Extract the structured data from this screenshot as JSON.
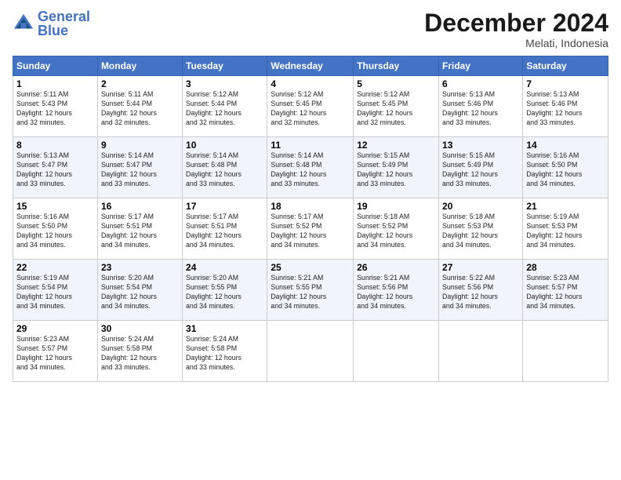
{
  "logo": {
    "line1": "General",
    "line2": "Blue"
  },
  "title": "December 2024",
  "location": "Melati, Indonesia",
  "days_header": [
    "Sunday",
    "Monday",
    "Tuesday",
    "Wednesday",
    "Thursday",
    "Friday",
    "Saturday"
  ],
  "weeks": [
    [
      {
        "day": "1",
        "sunrise": "5:11 AM",
        "sunset": "5:43 PM",
        "daylight": "12 hours and 32 minutes."
      },
      {
        "day": "2",
        "sunrise": "5:11 AM",
        "sunset": "5:44 PM",
        "daylight": "12 hours and 32 minutes."
      },
      {
        "day": "3",
        "sunrise": "5:12 AM",
        "sunset": "5:44 PM",
        "daylight": "12 hours and 32 minutes."
      },
      {
        "day": "4",
        "sunrise": "5:12 AM",
        "sunset": "5:45 PM",
        "daylight": "12 hours and 32 minutes."
      },
      {
        "day": "5",
        "sunrise": "5:12 AM",
        "sunset": "5:45 PM",
        "daylight": "12 hours and 32 minutes."
      },
      {
        "day": "6",
        "sunrise": "5:13 AM",
        "sunset": "5:46 PM",
        "daylight": "12 hours and 33 minutes."
      },
      {
        "day": "7",
        "sunrise": "5:13 AM",
        "sunset": "5:46 PM",
        "daylight": "12 hours and 33 minutes."
      }
    ],
    [
      {
        "day": "8",
        "sunrise": "5:13 AM",
        "sunset": "5:47 PM",
        "daylight": "12 hours and 33 minutes."
      },
      {
        "day": "9",
        "sunrise": "5:14 AM",
        "sunset": "5:47 PM",
        "daylight": "12 hours and 33 minutes."
      },
      {
        "day": "10",
        "sunrise": "5:14 AM",
        "sunset": "5:48 PM",
        "daylight": "12 hours and 33 minutes."
      },
      {
        "day": "11",
        "sunrise": "5:14 AM",
        "sunset": "5:48 PM",
        "daylight": "12 hours and 33 minutes."
      },
      {
        "day": "12",
        "sunrise": "5:15 AM",
        "sunset": "5:49 PM",
        "daylight": "12 hours and 33 minutes."
      },
      {
        "day": "13",
        "sunrise": "5:15 AM",
        "sunset": "5:49 PM",
        "daylight": "12 hours and 33 minutes."
      },
      {
        "day": "14",
        "sunrise": "5:16 AM",
        "sunset": "5:50 PM",
        "daylight": "12 hours and 34 minutes."
      }
    ],
    [
      {
        "day": "15",
        "sunrise": "5:16 AM",
        "sunset": "5:50 PM",
        "daylight": "12 hours and 34 minutes."
      },
      {
        "day": "16",
        "sunrise": "5:17 AM",
        "sunset": "5:51 PM",
        "daylight": "12 hours and 34 minutes."
      },
      {
        "day": "17",
        "sunrise": "5:17 AM",
        "sunset": "5:51 PM",
        "daylight": "12 hours and 34 minutes."
      },
      {
        "day": "18",
        "sunrise": "5:17 AM",
        "sunset": "5:52 PM",
        "daylight": "12 hours and 34 minutes."
      },
      {
        "day": "19",
        "sunrise": "5:18 AM",
        "sunset": "5:52 PM",
        "daylight": "12 hours and 34 minutes."
      },
      {
        "day": "20",
        "sunrise": "5:18 AM",
        "sunset": "5:53 PM",
        "daylight": "12 hours and 34 minutes."
      },
      {
        "day": "21",
        "sunrise": "5:19 AM",
        "sunset": "5:53 PM",
        "daylight": "12 hours and 34 minutes."
      }
    ],
    [
      {
        "day": "22",
        "sunrise": "5:19 AM",
        "sunset": "5:54 PM",
        "daylight": "12 hours and 34 minutes."
      },
      {
        "day": "23",
        "sunrise": "5:20 AM",
        "sunset": "5:54 PM",
        "daylight": "12 hours and 34 minutes."
      },
      {
        "day": "24",
        "sunrise": "5:20 AM",
        "sunset": "5:55 PM",
        "daylight": "12 hours and 34 minutes."
      },
      {
        "day": "25",
        "sunrise": "5:21 AM",
        "sunset": "5:55 PM",
        "daylight": "12 hours and 34 minutes."
      },
      {
        "day": "26",
        "sunrise": "5:21 AM",
        "sunset": "5:56 PM",
        "daylight": "12 hours and 34 minutes."
      },
      {
        "day": "27",
        "sunrise": "5:22 AM",
        "sunset": "5:56 PM",
        "daylight": "12 hours and 34 minutes."
      },
      {
        "day": "28",
        "sunrise": "5:23 AM",
        "sunset": "5:57 PM",
        "daylight": "12 hours and 34 minutes."
      }
    ],
    [
      {
        "day": "29",
        "sunrise": "5:23 AM",
        "sunset": "5:57 PM",
        "daylight": "12 hours and 34 minutes."
      },
      {
        "day": "30",
        "sunrise": "5:24 AM",
        "sunset": "5:58 PM",
        "daylight": "12 hours and 33 minutes."
      },
      {
        "day": "31",
        "sunrise": "5:24 AM",
        "sunset": "5:58 PM",
        "daylight": "12 hours and 33 minutes."
      },
      null,
      null,
      null,
      null
    ]
  ],
  "labels": {
    "sunrise": "Sunrise: ",
    "sunset": "Sunset: ",
    "daylight": "Daylight: "
  }
}
